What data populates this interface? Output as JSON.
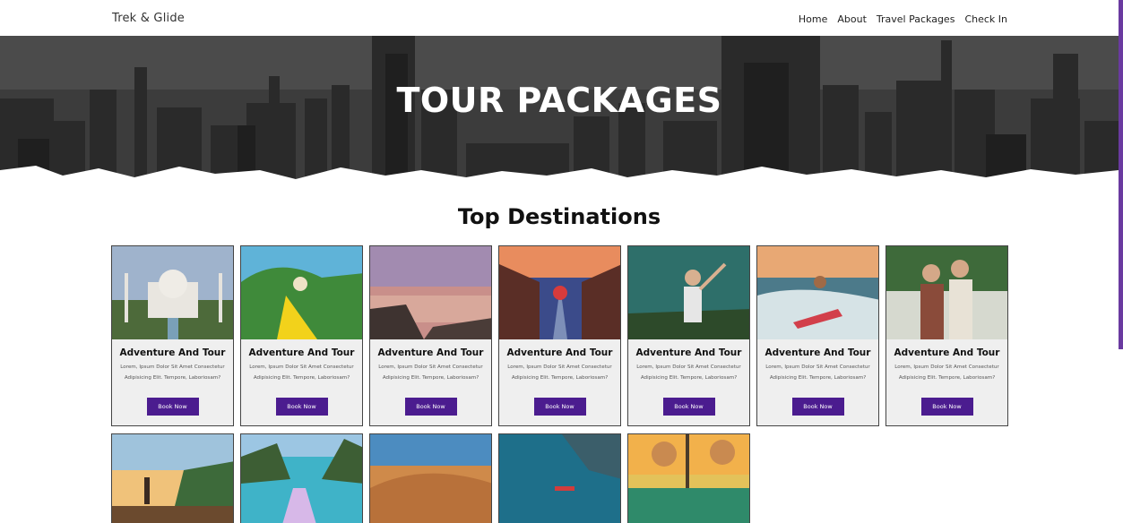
{
  "nav": {
    "brand": "Trek & Glide",
    "links": [
      "Home",
      "About",
      "Travel Packages",
      "Check In"
    ]
  },
  "hero": {
    "title": "TOUR PACKAGES"
  },
  "section": {
    "title": "Top Destinations"
  },
  "cards": [
    {
      "title": "Adventure And Tour",
      "desc": "Lorem, Ipsum Dolor Sit Amet Consectetur Adipisicing Elit. Tempore, Laboriosam?",
      "button": "Book Now",
      "photo": "taj-mahal"
    },
    {
      "title": "Adventure And Tour",
      "desc": "Lorem, Ipsum Dolor Sit Amet Consectetur Adipisicing Elit. Tempore, Laboriosam?",
      "button": "Book Now",
      "photo": "island-traveler"
    },
    {
      "title": "Adventure And Tour",
      "desc": "Lorem, Ipsum Dolor Sit Amet Consectetur Adipisicing Elit. Tempore, Laboriosam?",
      "button": "Book Now",
      "photo": "sunset-lake"
    },
    {
      "title": "Adventure And Tour",
      "desc": "Lorem, Ipsum Dolor Sit Amet Consectetur Adipisicing Elit. Tempore, Laboriosam?",
      "button": "Book Now",
      "photo": "kyoto-street"
    },
    {
      "title": "Adventure And Tour",
      "desc": "Lorem, Ipsum Dolor Sit Amet Consectetur Adipisicing Elit. Tempore, Laboriosam?",
      "button": "Book Now",
      "photo": "happy-traveler"
    },
    {
      "title": "Adventure And Tour",
      "desc": "Lorem, Ipsum Dolor Sit Amet Consectetur Adipisicing Elit. Tempore, Laboriosam?",
      "button": "Book Now",
      "photo": "surfer"
    },
    {
      "title": "Adventure And Tour",
      "desc": "Lorem, Ipsum Dolor Sit Amet Consectetur Adipisicing Elit. Tempore, Laboriosam?",
      "button": "Book Now",
      "photo": "couple-selfie"
    },
    {
      "photo": "beach-sunset"
    },
    {
      "photo": "boat-lagoon"
    },
    {
      "photo": "desert-dunes"
    },
    {
      "photo": "kayak-ocean"
    },
    {
      "photo": "resort-pool"
    }
  ],
  "colors": {
    "accent": "#4b1c8f",
    "scrollbar": "#6a3aa0"
  }
}
